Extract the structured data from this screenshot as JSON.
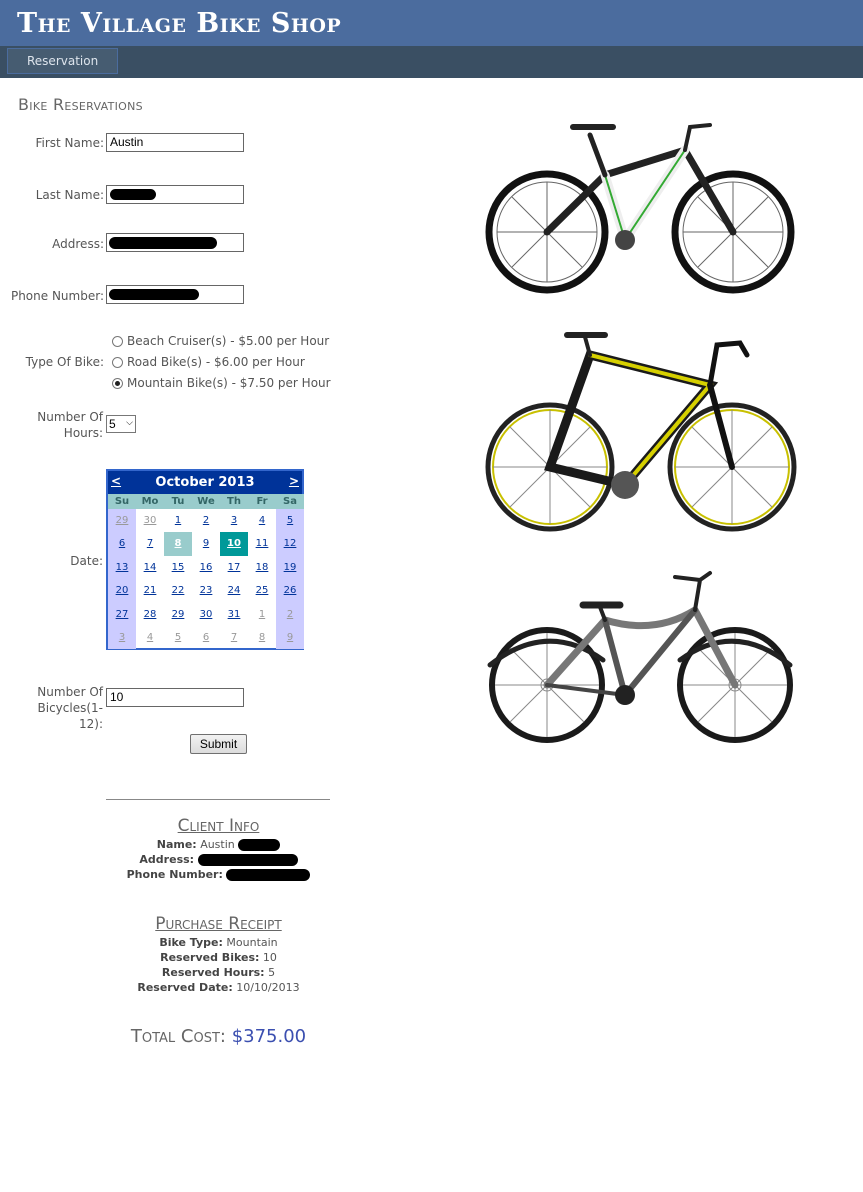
{
  "header": {
    "title": "The Village Bike Shop"
  },
  "menu": {
    "items": [
      "Reservation"
    ]
  },
  "page": {
    "heading": "Bike Reservations"
  },
  "form": {
    "first_name_label": "First Name:",
    "first_name_value": "Austin",
    "last_name_label": "Last Name:",
    "address_label": "Address:",
    "phone_label": "Phone Number:",
    "bike_type_label": "Type Of Bike:",
    "bike_options": [
      "Beach Cruiser(s) - $5.00 per Hour",
      "Road Bike(s) - $6.00 per Hour",
      "Mountain Bike(s) - $7.50 per Hour"
    ],
    "bike_selected": "Mountain Bike(s) - $7.50 per Hour",
    "hours_label_line1": "Number Of",
    "hours_label_line2": "Hours:",
    "hours_value": "5",
    "date_label": "Date:",
    "bicycles_label_line1": "Number Of",
    "bicycles_label_line2": "Bicycles(1-12):",
    "bicycles_value": "10",
    "submit_label": "Submit"
  },
  "calendar": {
    "prev": "<",
    "next": ">",
    "month": "October 2013",
    "days_of_week": [
      "Su",
      "Mo",
      "Tu",
      "We",
      "Th",
      "Fr",
      "Sa"
    ],
    "days": [
      "29",
      "30",
      "1",
      "2",
      "3",
      "4",
      "5",
      "6",
      "7",
      "8",
      "9",
      "10",
      "11",
      "12",
      "13",
      "14",
      "15",
      "16",
      "17",
      "18",
      "19",
      "20",
      "21",
      "22",
      "23",
      "24",
      "25",
      "26",
      "27",
      "28",
      "29",
      "30",
      "31",
      "1",
      "2",
      "3",
      "4",
      "5",
      "6",
      "7",
      "8",
      "9"
    ],
    "today": "8",
    "selected": "10"
  },
  "client_info": {
    "title": "Client Info",
    "name_label": "Name:",
    "name_value": "Austin",
    "address_label": "Address:",
    "phone_label": "Phone Number:"
  },
  "receipt": {
    "title": "Purchase Receipt",
    "bike_type_label": "Bike Type:",
    "bike_type_value": "Mountain",
    "reserved_bikes_label": "Reserved Bikes:",
    "reserved_bikes_value": "10",
    "reserved_hours_label": "Reserved Hours:",
    "reserved_hours_value": "5",
    "reserved_date_label": "Reserved Date:",
    "reserved_date_value": "10/10/2013"
  },
  "total": {
    "label": "Total Cost:",
    "value": "$375.00"
  },
  "colors": {
    "header": "#4b6c9e",
    "menubar": "#3a4f63",
    "calendar_head": "#003399",
    "selected_day": "#009999"
  }
}
